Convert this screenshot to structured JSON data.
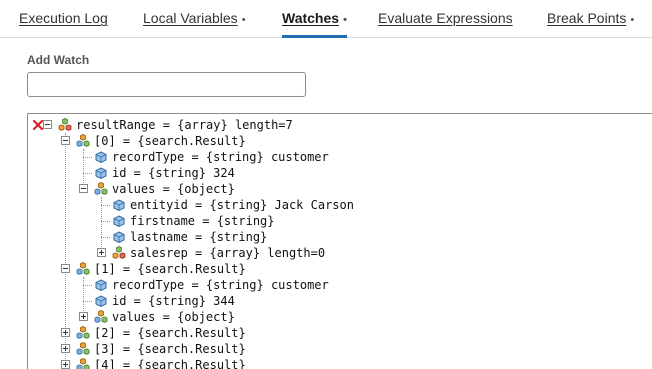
{
  "tabs": [
    {
      "label": "Execution Log",
      "dot": ""
    },
    {
      "label": "Local Variables",
      "dot": "•"
    },
    {
      "label": "Watches",
      "dot": "•"
    },
    {
      "label": "Evaluate Expressions",
      "dot": ""
    },
    {
      "label": "Break Points",
      "dot": "•"
    }
  ],
  "add_watch": {
    "label": "Add Watch",
    "value": ""
  },
  "tree": [
    {
      "text": "resultRange = {array} length=7",
      "icon": "array-icon",
      "toggle": "minus",
      "removable": true
    },
    {
      "text": "[0] = {search.Result}",
      "icon": "object-icon",
      "toggle": "minus"
    },
    {
      "text": "recordType = {string} customer",
      "icon": "field-icon"
    },
    {
      "text": "id = {string} 324",
      "icon": "field-icon"
    },
    {
      "text": "values = {object}",
      "icon": "object-icon",
      "toggle": "minus"
    },
    {
      "text": "entityid = {string} Jack Carson",
      "icon": "field-icon"
    },
    {
      "text": "firstname = {string}",
      "icon": "field-icon"
    },
    {
      "text": "lastname = {string}",
      "icon": "field-icon"
    },
    {
      "text": "salesrep = {array} length=0",
      "icon": "array-icon",
      "toggle": "plus"
    },
    {
      "text": "[1] = {search.Result}",
      "icon": "object-icon",
      "toggle": "minus"
    },
    {
      "text": "recordType = {string} customer",
      "icon": "field-icon"
    },
    {
      "text": "id = {string} 344",
      "icon": "field-icon"
    },
    {
      "text": "values = {object}",
      "icon": "object-icon",
      "toggle": "plus"
    },
    {
      "text": "[2] = {search.Result}",
      "icon": "object-icon",
      "toggle": "plus"
    },
    {
      "text": "[3] = {search.Result}",
      "icon": "object-icon",
      "toggle": "plus"
    },
    {
      "text": "[4] = {search.Result}",
      "icon": "object-icon",
      "toggle": "plus"
    }
  ],
  "colors": {
    "active_tab_underline": "#1f6fb2",
    "remove": "#d9262b"
  }
}
